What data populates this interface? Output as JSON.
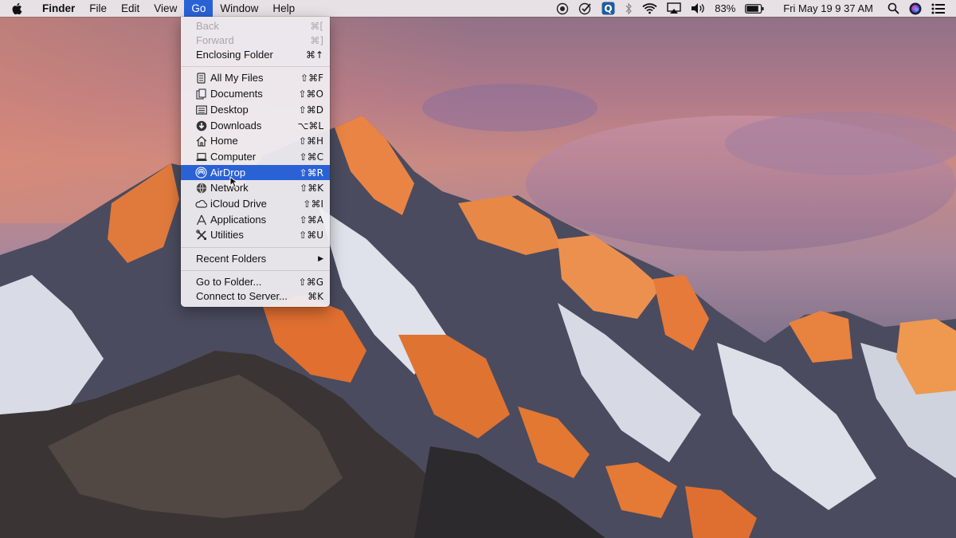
{
  "menubar": {
    "apple_icon": "apple-logo-icon",
    "app_name": "Finder",
    "menus": [
      "File",
      "Edit",
      "View",
      "Go",
      "Window",
      "Help"
    ],
    "active_menu": "Go",
    "status": {
      "icons": [
        "record-icon",
        "checkmark-circle-icon",
        "q-app-icon",
        "bluetooth-icon",
        "wifi-icon",
        "airplay-icon",
        "volume-icon",
        "battery-icon",
        "search-icon",
        "siri-icon",
        "notification-center-icon"
      ],
      "battery_percent": "83%",
      "datetime": "Fri May 19  9 37 AM"
    }
  },
  "go_menu": {
    "items": [
      {
        "label": "Back",
        "shortcut": "⌘[",
        "disabled": true
      },
      {
        "label": "Forward",
        "shortcut": "⌘]",
        "disabled": true
      },
      {
        "label": "Enclosing Folder",
        "shortcut": "⌘↑"
      },
      {
        "label": "All My Files",
        "shortcut": "⇧⌘F",
        "icon": "all-files-icon"
      },
      {
        "label": "Documents",
        "shortcut": "⇧⌘O",
        "icon": "documents-icon"
      },
      {
        "label": "Desktop",
        "shortcut": "⇧⌘D",
        "icon": "desktop-icon"
      },
      {
        "label": "Downloads",
        "shortcut": "⌥⌘L",
        "icon": "downloads-icon"
      },
      {
        "label": "Home",
        "shortcut": "⇧⌘H",
        "icon": "home-icon"
      },
      {
        "label": "Computer",
        "shortcut": "⇧⌘C",
        "icon": "computer-icon"
      },
      {
        "label": "AirDrop",
        "shortcut": "⇧⌘R",
        "icon": "airdrop-icon",
        "highlighted": true
      },
      {
        "label": "Network",
        "shortcut": "⇧⌘K",
        "icon": "network-icon"
      },
      {
        "label": "iCloud Drive",
        "shortcut": "⇧⌘I",
        "icon": "icloud-icon"
      },
      {
        "label": "Applications",
        "shortcut": "⇧⌘A",
        "icon": "applications-icon"
      },
      {
        "label": "Utilities",
        "shortcut": "⇧⌘U",
        "icon": "utilities-icon"
      },
      {
        "label": "Recent Folders",
        "shortcut": "▶"
      },
      {
        "label": "Go to Folder...",
        "shortcut": "⇧⌘G"
      },
      {
        "label": "Connect to Server...",
        "shortcut": "⌘K"
      }
    ]
  },
  "colors": {
    "highlight": "#2a62d6"
  }
}
